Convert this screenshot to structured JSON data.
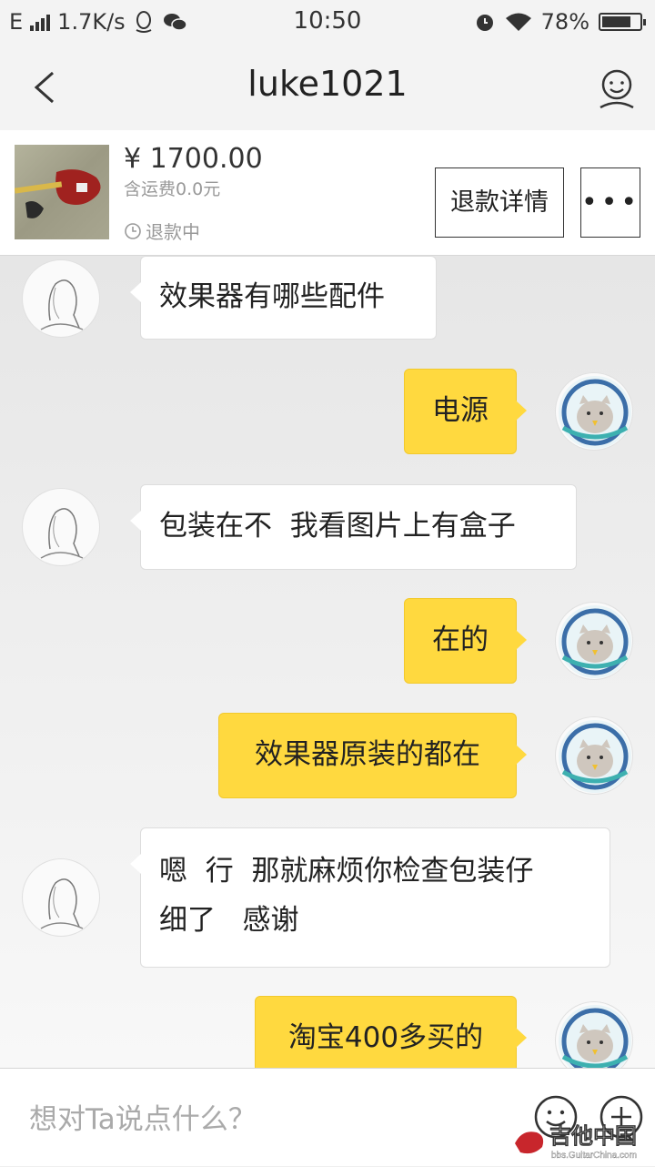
{
  "status_bar": {
    "network": "E",
    "speed": "1.7K/s",
    "time": "10:50",
    "battery": "78%",
    "battery_level": 0.78,
    "icons": [
      "signal-icon",
      "qq-icon",
      "wechat-icon",
      "alarm-icon",
      "wifi-icon",
      "battery-icon"
    ]
  },
  "header": {
    "title": "luke1021",
    "back_icon": "back-chevron-icon",
    "profile_icon": "profile-icon"
  },
  "product": {
    "price": "¥ 1700.00",
    "shipping": "含运费0.0元",
    "status": "退款中",
    "refund_button": "退款详情",
    "more_icon": "more-dots-icon"
  },
  "messages": [
    {
      "side": "in",
      "text": "效果器有哪些配件"
    },
    {
      "side": "out",
      "text": "电源"
    },
    {
      "side": "in",
      "text": "包装在不  我看图片上有盒子"
    },
    {
      "side": "out",
      "text": "在的"
    },
    {
      "side": "out",
      "text": "效果器原装的都在"
    },
    {
      "side": "in",
      "text_line1": "嗯  行  那就麻烦你检查包装仔",
      "text_line2": "细了   感谢"
    },
    {
      "side": "out",
      "text": "淘宝400多买的"
    }
  ],
  "input": {
    "placeholder": "想对Ta说点什么？",
    "emoji_icon": "emoji-icon",
    "plus_icon": "plus-icon"
  },
  "watermark": {
    "text": "吉他中国",
    "url_text": "bbs.GuitarChina.com"
  },
  "colors": {
    "outgoing_bubble": "#ffd93f",
    "incoming_bubble": "#ffffff",
    "background": "#efefef"
  }
}
